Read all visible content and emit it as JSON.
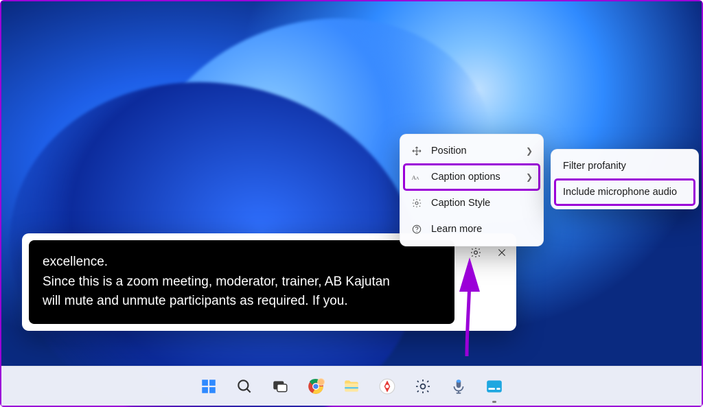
{
  "caption": {
    "line1": "excellence.",
    "line2": "Since this is a zoom meeting, moderator, trainer, AB Kajutan",
    "line3": "will mute and unmute participants as required. If you."
  },
  "menu": {
    "position": "Position",
    "caption_options": "Caption options",
    "caption_style": "Caption Style",
    "learn_more": "Learn more"
  },
  "submenu": {
    "filter_profanity": "Filter profanity",
    "include_mic": "Include microphone audio"
  },
  "controls": {
    "settings": "Settings",
    "close": "Close"
  },
  "taskbar": {
    "start": "Start",
    "search": "Search",
    "taskview": "Task view",
    "chrome": "Google Chrome",
    "explorer": "File Explorer",
    "app1": "App",
    "settings": "Settings",
    "mic_app": "Microphone app",
    "captions": "Live Captions"
  },
  "colors": {
    "highlight": "#9b00d8"
  }
}
